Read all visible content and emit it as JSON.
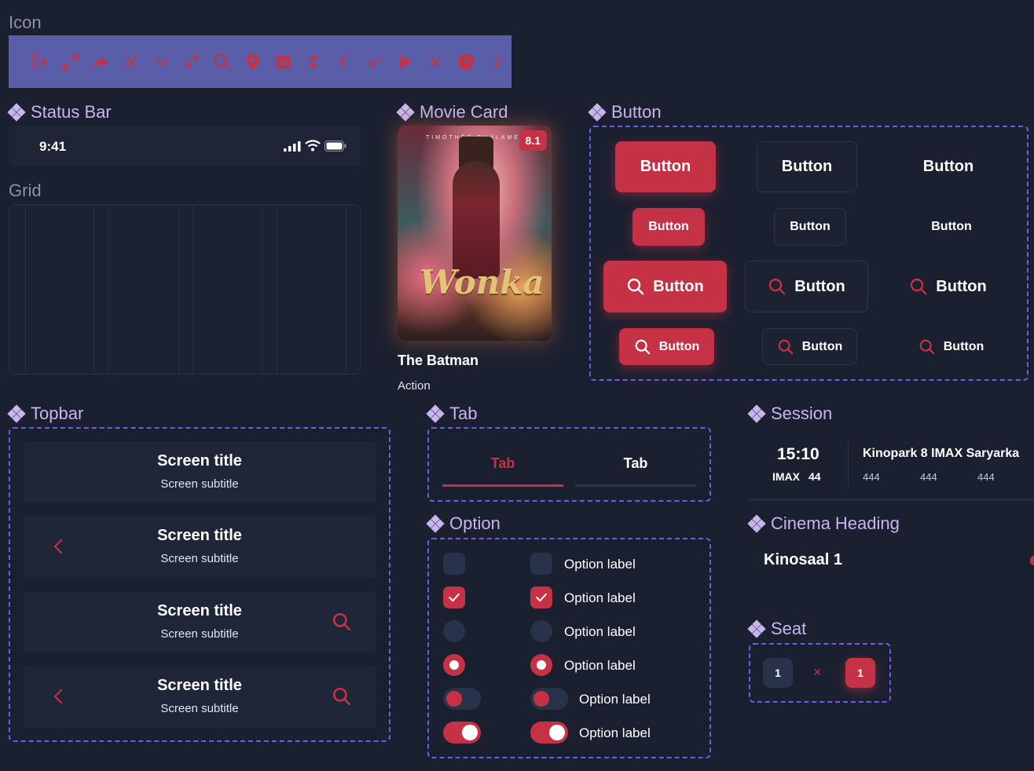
{
  "colors": {
    "background": "#1b2030",
    "accent": "#c53145",
    "section_title": "#c9b5ee",
    "dashed_border": "#6a5ee6",
    "icon_strip": "#5a5ea8"
  },
  "sections": {
    "icon": "Icon",
    "status_bar": "Status Bar",
    "grid": "Grid",
    "movie_card": "Movie Card",
    "button": "Button",
    "topbar": "Topbar",
    "tab": "Tab",
    "option": "Option",
    "session": "Session",
    "cinema_heading": "Cinema Heading",
    "seat": "Seat"
  },
  "icons": [
    "logout-icon",
    "expand-icon",
    "share-icon",
    "close-icon",
    "chevron-down-icon",
    "collapse-icon",
    "search-icon",
    "location-pin-icon",
    "calendar-icon",
    "sort-icon",
    "chevron-left-icon",
    "check-icon",
    "play-icon",
    "close-small-icon",
    "clock-icon",
    "chevron-right-icon"
  ],
  "status_bar": {
    "time": "9:41",
    "icons": [
      "signal-icon",
      "wifi-icon",
      "battery-icon"
    ]
  },
  "movie_card": {
    "rating": "8.1",
    "title": "The Batman",
    "genre": "Action",
    "poster_logo": "Wonka",
    "poster_top": "TIMOTHÉE CHALAMET"
  },
  "buttons": {
    "label": "Button"
  },
  "topbar": {
    "title": "Screen title",
    "subtitle": "Screen subtitle"
  },
  "tabs": {
    "active": "Tab",
    "inactive": "Tab"
  },
  "options": {
    "label": "Option label"
  },
  "session": {
    "time": "15:10",
    "format": "IMAX",
    "hall": "44",
    "cinema": "Kinopark 8 IMAX Saryarka",
    "prices": [
      "444",
      "444",
      "444"
    ]
  },
  "cinema_heading": {
    "name": "Kinosaal 1"
  },
  "seat": {
    "seat_a": "1",
    "seat_b": "1",
    "separator": "×"
  }
}
